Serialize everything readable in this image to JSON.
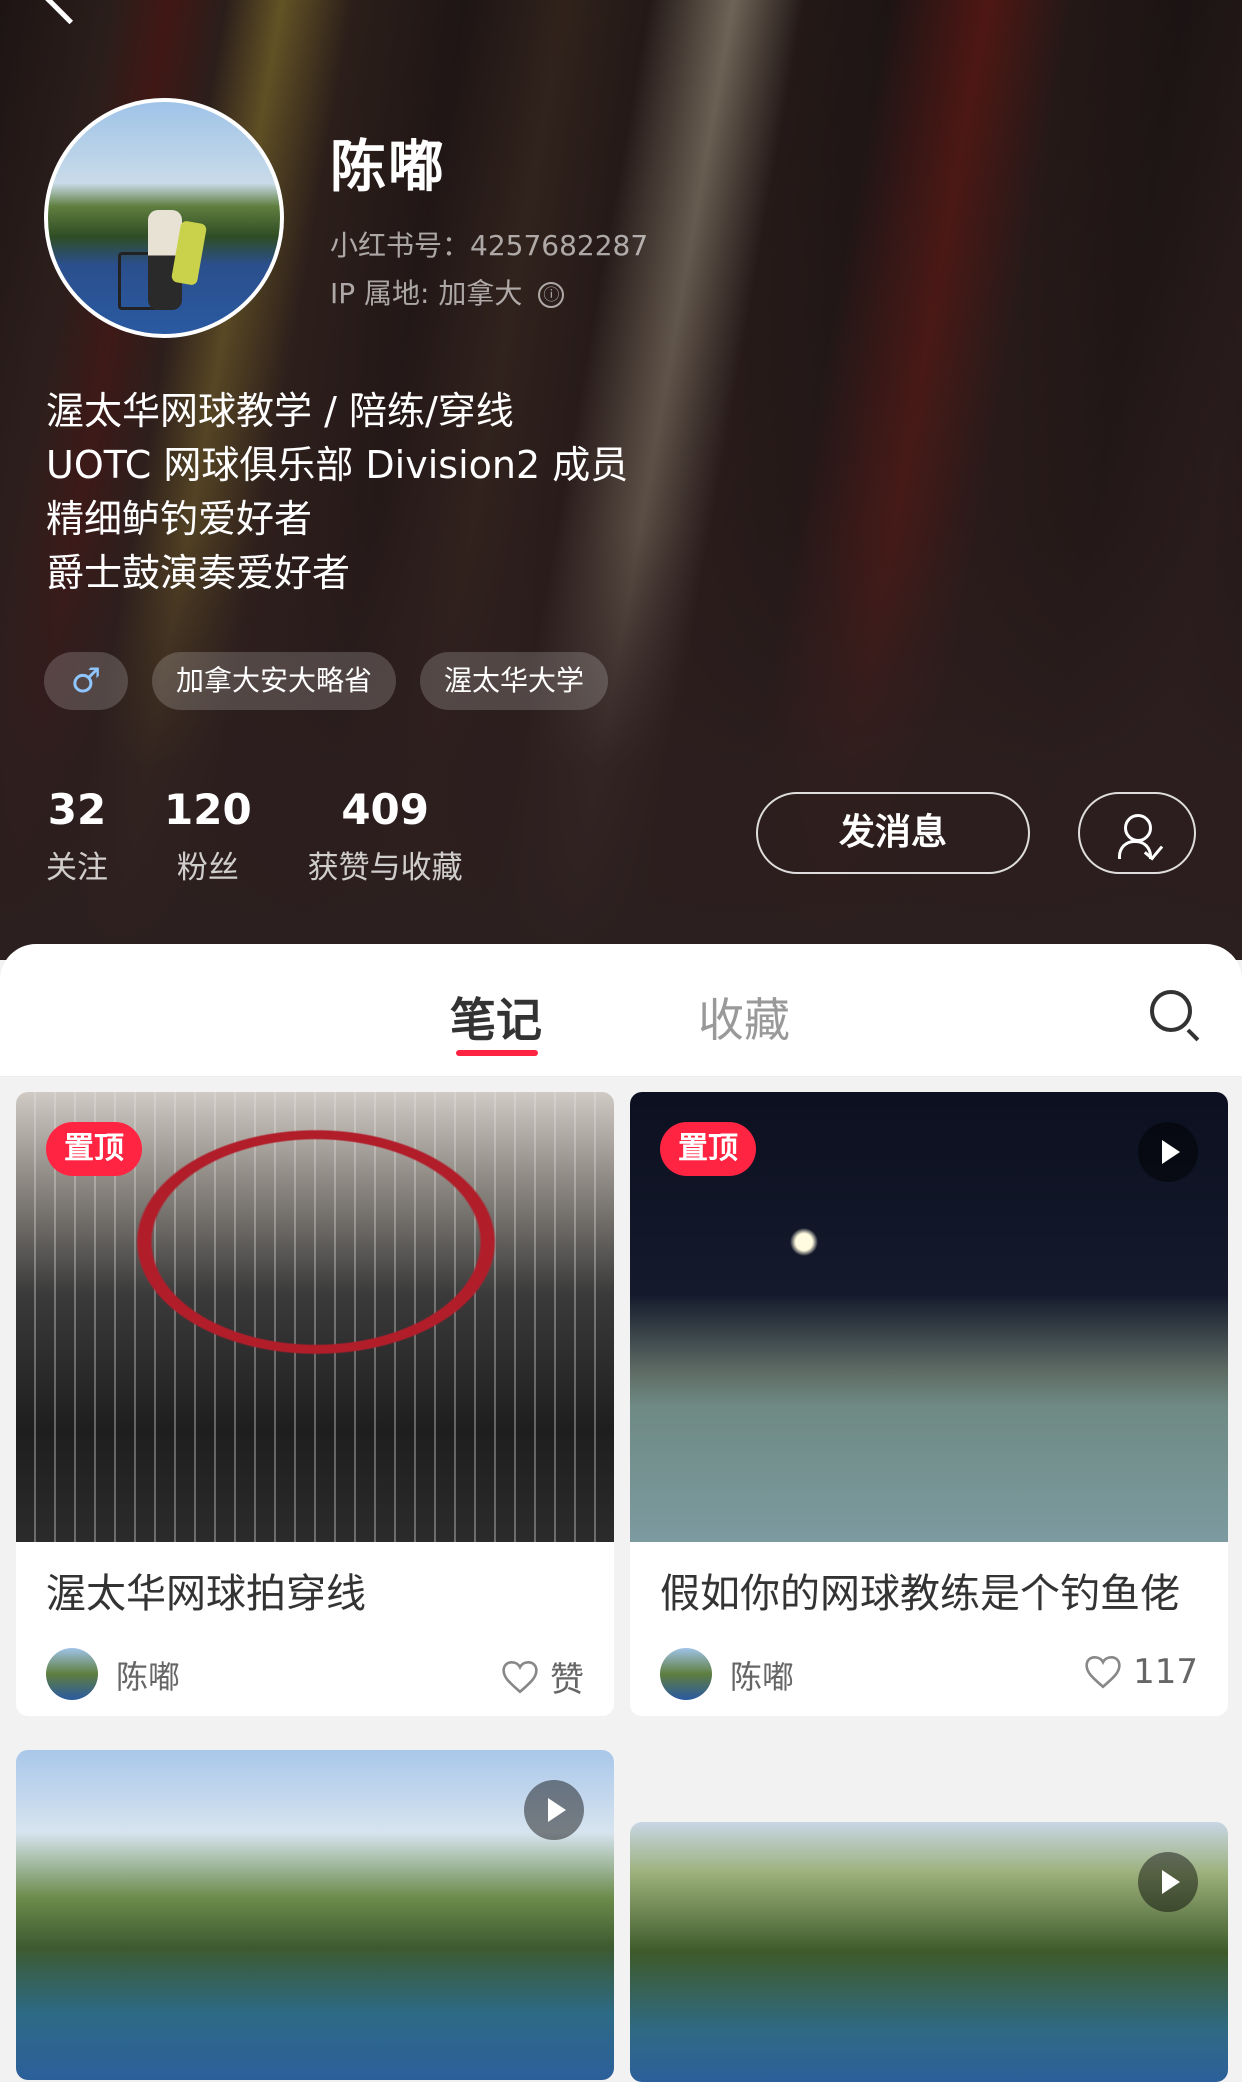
{
  "profile": {
    "name": "陈嘟",
    "id_text": "小红书号：4257682287",
    "ip_text": "IP 属地: 加拿大",
    "bio": [
      "渥太华网球教学 / 陪练/穿线",
      "UOTC 网球俱乐部 Division2 成员",
      "精细鲈钓爱好者",
      "爵士鼓演奏爱好者"
    ],
    "tags": [
      "♂",
      "加拿大安大略省",
      "渥太华大学"
    ],
    "stats": [
      {
        "num": "32",
        "label": "关注"
      },
      {
        "num": "120",
        "label": "粉丝"
      },
      {
        "num": "409",
        "label": "获赞与收藏"
      }
    ],
    "message_button": "发消息",
    "info_icon": "ⓘ"
  },
  "tabs": {
    "notes": "笔记",
    "collections": "收藏"
  },
  "feed": {
    "pin_label": "置顶",
    "cards": [
      {
        "title": "渥太华网球拍穿线",
        "author": "陈嘟",
        "likes": "赞",
        "pinned": true,
        "video": false
      },
      {
        "title": "假如你的网球教练是个钓鱼佬",
        "author": "陈嘟",
        "likes": "117",
        "pinned": true,
        "video": true
      },
      {
        "title": "",
        "author": "",
        "likes": "",
        "pinned": false,
        "video": true
      },
      {
        "title": "",
        "author": "",
        "likes": "",
        "pinned": false,
        "video": true
      }
    ]
  },
  "colors": {
    "accent": "#ff2442",
    "header_bg": "#2c1f1f"
  },
  "icons": [
    "back-icon",
    "info-icon",
    "gender-male-icon",
    "follow-status-icon",
    "search-icon",
    "play-icon",
    "heart-icon"
  ]
}
